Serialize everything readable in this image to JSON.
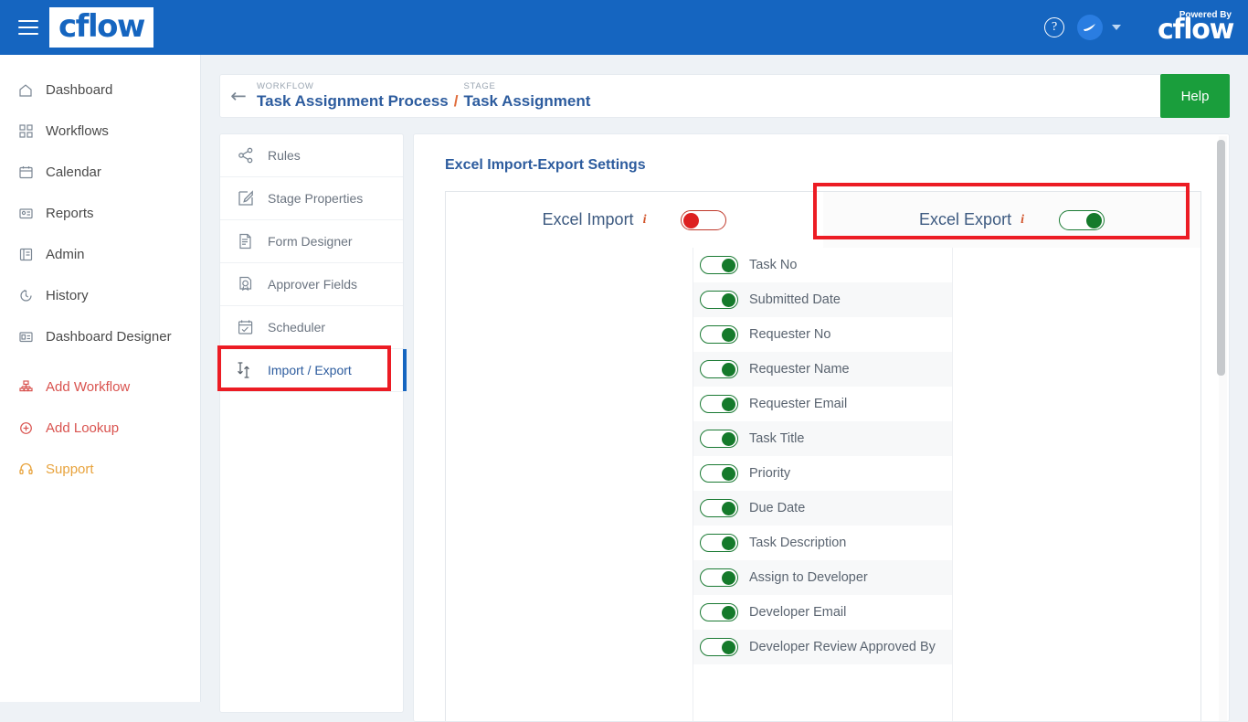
{
  "topbar": {
    "menu_icon": "hamburger-icon",
    "brand": "cflow",
    "help_icon": "question-circle-icon",
    "avatar_icon": "user-avatar-icon",
    "chevron_icon": "chevron-down-icon",
    "powered_by_label": "Powered By",
    "powered_by_brand": "cflow"
  },
  "sidebar": {
    "items": [
      {
        "label": "Dashboard",
        "icon": "home-icon",
        "tone": "default"
      },
      {
        "label": "Workflows",
        "icon": "grid-icon",
        "tone": "default"
      },
      {
        "label": "Calendar",
        "icon": "calendar-icon",
        "tone": "default"
      },
      {
        "label": "Reports",
        "icon": "report-icon",
        "tone": "default"
      },
      {
        "label": "Admin",
        "icon": "admin-book-icon",
        "tone": "default"
      },
      {
        "label": "History",
        "icon": "clock-history-icon",
        "tone": "default"
      },
      {
        "label": "Dashboard Designer",
        "icon": "dashboard-designer-icon",
        "tone": "default"
      },
      {
        "label": "Add Workflow",
        "icon": "add-workflow-icon",
        "tone": "red"
      },
      {
        "label": "Add Lookup",
        "icon": "add-lookup-icon",
        "tone": "red"
      },
      {
        "label": "Support",
        "icon": "headset-icon",
        "tone": "orange"
      }
    ]
  },
  "breadcrumb": {
    "back_icon": "arrow-left-icon",
    "workflow_kicker": "WORKFLOW",
    "workflow_name": "Task Assignment Process",
    "separator": "/",
    "stage_kicker": "STAGE",
    "stage_name": "Task Assignment"
  },
  "help_button": {
    "label": "Help",
    "color": "#1a9e3c"
  },
  "stage_menu": {
    "items": [
      {
        "label": "Rules",
        "icon": "share-nodes-icon",
        "active": false
      },
      {
        "label": "Stage Properties",
        "icon": "edit-square-icon",
        "active": false
      },
      {
        "label": "Form Designer",
        "icon": "form-pencil-icon",
        "active": false
      },
      {
        "label": "Approver Fields",
        "icon": "approver-doc-icon",
        "active": false
      },
      {
        "label": "Scheduler",
        "icon": "calendar-check-icon",
        "active": false
      },
      {
        "label": "Import / Export",
        "icon": "import-export-arrows-icon",
        "active": true
      }
    ]
  },
  "content": {
    "title": "Excel Import-Export Settings",
    "import_panel": {
      "label": "Excel Import",
      "info_icon": "info-italic-icon",
      "info_glyph": "i",
      "toggle_state": "off",
      "toggle_color": "#dd2020"
    },
    "export_panel": {
      "label": "Excel Export",
      "info_icon": "info-italic-icon",
      "info_glyph": "i",
      "toggle_state": "on",
      "toggle_color": "#157a2b"
    },
    "export_fields": [
      {
        "label": "Task No",
        "state": "on"
      },
      {
        "label": "Submitted Date",
        "state": "on"
      },
      {
        "label": "Requester No",
        "state": "on"
      },
      {
        "label": "Requester Name",
        "state": "on"
      },
      {
        "label": "Requester Email",
        "state": "on"
      },
      {
        "label": "Task Title",
        "state": "on"
      },
      {
        "label": "Priority",
        "state": "on"
      },
      {
        "label": "Due Date",
        "state": "on"
      },
      {
        "label": "Task Description",
        "state": "on"
      },
      {
        "label": "Assign to Developer",
        "state": "on"
      },
      {
        "label": "Developer Email",
        "state": "on"
      },
      {
        "label": "Developer Review Approved By",
        "state": "on"
      }
    ]
  },
  "annotations": {
    "highlight_color": "#ec1c24",
    "boxes": [
      {
        "name": "import-export-menu-highlight"
      },
      {
        "name": "excel-export-panel-highlight"
      }
    ]
  },
  "scrollbar": {
    "name": "content-vertical-scrollbar"
  }
}
